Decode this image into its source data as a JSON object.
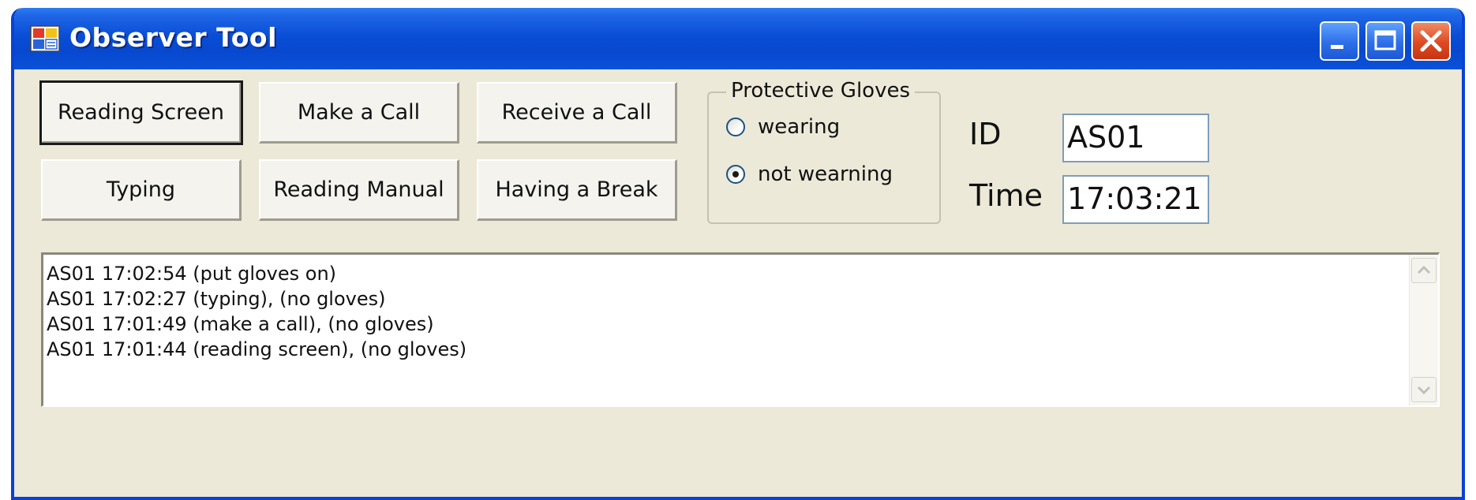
{
  "window": {
    "title": "Observer Tool"
  },
  "activity_buttons": [
    {
      "label": "Reading Screen"
    },
    {
      "label": "Make a Call"
    },
    {
      "label": "Receive a Call"
    },
    {
      "label": "Typing"
    },
    {
      "label": "Reading Manual"
    },
    {
      "label": "Having a Break"
    }
  ],
  "gloves_group": {
    "legend": "Protective Gloves",
    "options": [
      {
        "label": "wearing",
        "selected": false
      },
      {
        "label": "not wearning",
        "selected": true
      }
    ]
  },
  "fields": {
    "id_label": "ID",
    "id_value": "AS01",
    "time_label": "Time",
    "time_value": "17:03:21"
  },
  "log": {
    "lines": [
      "AS01 17:02:54 (put gloves on)",
      "AS01 17:02:27 (typing), (no gloves)",
      "AS01 17:01:49 (make a call), (no gloves)",
      "AS01 17:01:44 (reading screen), (no gloves)"
    ]
  },
  "colors": {
    "titlebar": "#0a4ed6",
    "window_bg": "#ece9d8",
    "close_button": "#dc4a22"
  }
}
